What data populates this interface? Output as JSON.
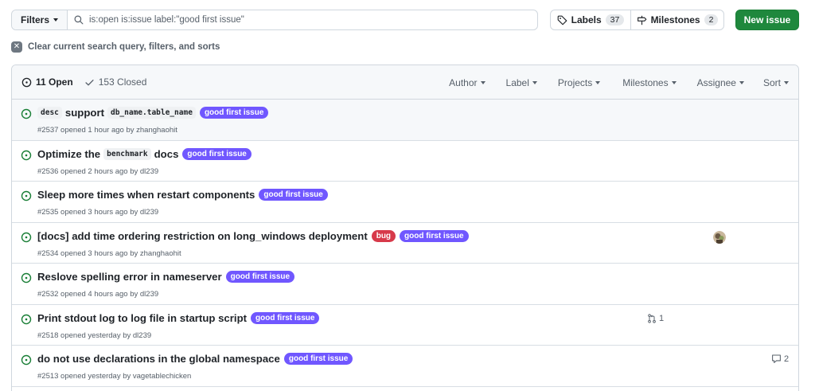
{
  "toolbar": {
    "filters_label": "Filters",
    "search_value": "is:open is:issue label:\"good first issue\"",
    "labels_label": "Labels",
    "labels_count": "37",
    "milestones_label": "Milestones",
    "milestones_count": "2",
    "new_issue_label": "New issue"
  },
  "clear_filters_label": "Clear current search query, filters, and sorts",
  "list_header": {
    "open_label": "11 Open",
    "closed_label": "153 Closed",
    "filters": [
      "Author",
      "Label",
      "Projects",
      "Milestones",
      "Assignee",
      "Sort"
    ]
  },
  "colors": {
    "open_green": "#1a7f37",
    "good_first_issue": "#7057ff",
    "bug": "#d73a4a",
    "new_issue_button": "#1f883d"
  },
  "issues": [
    {
      "segments": [
        {
          "kind": "code",
          "text": "desc"
        },
        {
          "kind": "text",
          "text": "support"
        },
        {
          "kind": "code",
          "text": "db_name.table_name"
        }
      ],
      "labels": [
        {
          "name": "good first issue",
          "color": "#7057ff"
        }
      ],
      "meta": "#2537 opened 1 hour ago by zhanghaohit",
      "pr_count": null,
      "comments": null,
      "assignee_avatar": false
    },
    {
      "segments": [
        {
          "kind": "text",
          "text": "Optimize the"
        },
        {
          "kind": "code",
          "text": "benchmark"
        },
        {
          "kind": "text",
          "text": "docs"
        }
      ],
      "labels": [
        {
          "name": "good first issue",
          "color": "#7057ff"
        }
      ],
      "meta": "#2536 opened 2 hours ago by dl239",
      "pr_count": null,
      "comments": null,
      "assignee_avatar": false
    },
    {
      "segments": [
        {
          "kind": "text",
          "text": "Sleep more times when restart components"
        }
      ],
      "labels": [
        {
          "name": "good first issue",
          "color": "#7057ff"
        }
      ],
      "meta": "#2535 opened 3 hours ago by dl239",
      "pr_count": null,
      "comments": null,
      "assignee_avatar": false
    },
    {
      "segments": [
        {
          "kind": "text",
          "text": "[docs] add time ordering restriction on long_windows deployment"
        }
      ],
      "labels": [
        {
          "name": "bug",
          "color": "#d73a4a"
        },
        {
          "name": "good first issue",
          "color": "#7057ff"
        }
      ],
      "meta": "#2534 opened 3 hours ago by zhanghaohit",
      "pr_count": null,
      "comments": null,
      "assignee_avatar": true
    },
    {
      "segments": [
        {
          "kind": "text",
          "text": "Reslove spelling error in nameserver"
        }
      ],
      "labels": [
        {
          "name": "good first issue",
          "color": "#7057ff"
        }
      ],
      "meta": "#2532 opened 4 hours ago by dl239",
      "pr_count": null,
      "comments": null,
      "assignee_avatar": false
    },
    {
      "segments": [
        {
          "kind": "text",
          "text": "Print stdout log to log file in startup script"
        }
      ],
      "labels": [
        {
          "name": "good first issue",
          "color": "#7057ff"
        }
      ],
      "meta": "#2518 opened yesterday by dl239",
      "pr_count": "1",
      "comments": null,
      "assignee_avatar": false
    },
    {
      "segments": [
        {
          "kind": "text",
          "text": "do not use declarations in the global namespace"
        }
      ],
      "labels": [
        {
          "name": "good first issue",
          "color": "#7057ff"
        }
      ],
      "meta": "#2513 opened yesterday by vagetablechicken",
      "pr_count": null,
      "comments": "2",
      "assignee_avatar": false
    }
  ]
}
